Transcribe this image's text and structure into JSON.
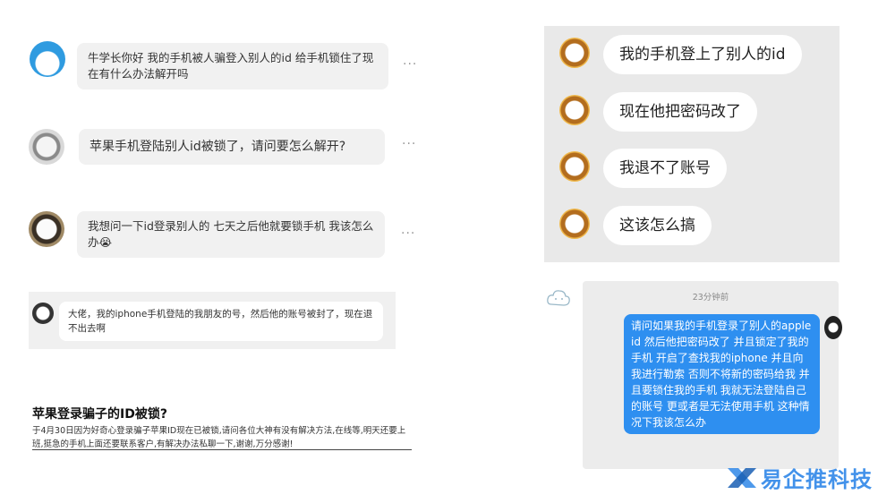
{
  "left": {
    "chats": [
      {
        "text": "牛学长你好 我的手机被人骗登入别人的id 给手机锁住了现在有什么办法解开吗",
        "more": "···"
      },
      {
        "text": "苹果手机登陆别人id被锁了，请问要怎么解开?",
        "more": "···"
      },
      {
        "text": "我想问一下id登录别人的 七天之后他就要锁手机 我该怎么办😭",
        "more": "···"
      },
      {
        "text": "大佬，我的iphone手机登陆的我朋友的号，然后他的账号被封了，现在退不出去啊"
      }
    ],
    "post": {
      "title": "苹果登录骗子的ID被锁?",
      "body": "于4月30日因为好奇心登录骗子苹果ID现在已被锁,请问各位大神有没有解决方法,在线等,明天还要上班,挺急的手机上面还要联系客户,有解决办法私聊一下,谢谢,万分感谢!"
    }
  },
  "right_top": {
    "messages": [
      "我的手机登上了别人的id",
      "现在他把密码改了",
      "我退不了账号",
      "这该怎么搞"
    ]
  },
  "right_bottom": {
    "timestamp": "23分钟前",
    "message": "请问如果我的手机登录了别人的apple id 然后他把密码改了 并且锁定了我的手机 开启了查找我的iphone 并且向我进行勒索 否则不将新的密码给我 并且要锁住我的手机 我就无法登陆自己的账号 更或者是无法使用手机 这种情况下我该怎么办"
  },
  "watermark": {
    "text": "易企推科技",
    "color": "#2f87e8"
  }
}
